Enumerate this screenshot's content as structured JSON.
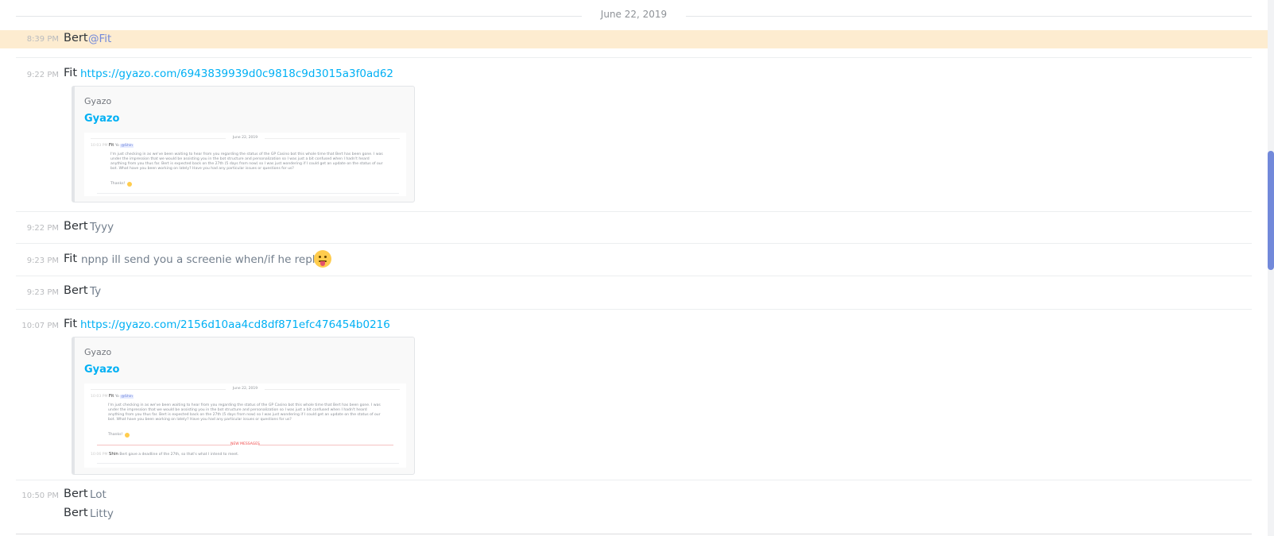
{
  "date_divider": "June 22, 2019",
  "messages": [
    {
      "time": "8:39 PM",
      "author": "Bert",
      "mention": "@Fit"
    },
    {
      "time": "9:22 PM",
      "author": "Fit",
      "link": "https://gyazo.com/6943839939d0c9818c9d3015a3f0ad62",
      "embed": {
        "provider": "Gyazo",
        "title": "Gyazo",
        "thumb": {
          "date": "June 22, 2019",
          "time": "10:03 PM",
          "author": "Fit",
          "prefix": "Yo",
          "mention": "@Shin",
          "lines": [
            "I'm just checking in as we've been waiting to hear from you regarding the status of the GP Casino bot this whole time that Bert has been gone. I was",
            "under the impression that we would be assisting you in the bot structure and personalization so I was just a bit confused when I hadn't heard",
            "anything from you thus far. Bert is expected back on the 27th (5 days from now) so I was just wondering if I could get an update on the status of our",
            "bot. What have you been working on lately? Have you had any particular issues or questions for us?"
          ],
          "thanks": "Thanks!"
        }
      }
    },
    {
      "time": "9:22 PM",
      "author": "Bert",
      "text": "Tyyy"
    },
    {
      "time": "9:23 PM",
      "author": "Fit",
      "text": "npnp ill send you a screenie when/if he replies"
    },
    {
      "time": "9:23 PM",
      "author": "Bert",
      "text": "Ty"
    },
    {
      "time": "10:07 PM",
      "author": "Fit",
      "link": "https://gyazo.com/2156d10aa4cd8df871efc476454b0216",
      "embed": {
        "provider": "Gyazo",
        "title": "Gyazo",
        "thumb": {
          "date": "June 22, 2019",
          "time": "10:03 PM",
          "author": "Fit",
          "prefix": "Yo",
          "mention": "@Shin",
          "lines": [
            "I'm just checking in as we've been waiting to hear from you regarding the status of the GP Casino bot this whole time that Bert has been gone. I was",
            "under the impression that we would be assisting you in the bot structure and personalization so I was just a bit confused when I hadn't heard",
            "anything from you thus far. Bert is expected back on the 27th (5 days from now) so I was just wondering if I could get an update on the status of our",
            "bot. What have you been working on lately? Have you had any particular issues or questions for us?"
          ],
          "thanks": "Thanks!",
          "new_messages": "NEW MESSAGES",
          "reply_time": "10:06 PM",
          "reply_author": "Shin",
          "reply_text": "Bert gave a deadline of the 27th, so that's what I intend to meet."
        }
      }
    },
    {
      "time": "10:50 PM",
      "author": "Bert",
      "text": "Lot"
    },
    {
      "author": "Bert",
      "text": "Litty"
    }
  ],
  "icons": {
    "emoji_tongue": "stuck-out-tongue-emoji",
    "emoji_grin": "grinning-emoji"
  },
  "colors": {
    "link": "#00b0f4",
    "mention": "#7289da",
    "mention_highlight": "#fdecd0",
    "scroll_thumb": "#7289da"
  }
}
